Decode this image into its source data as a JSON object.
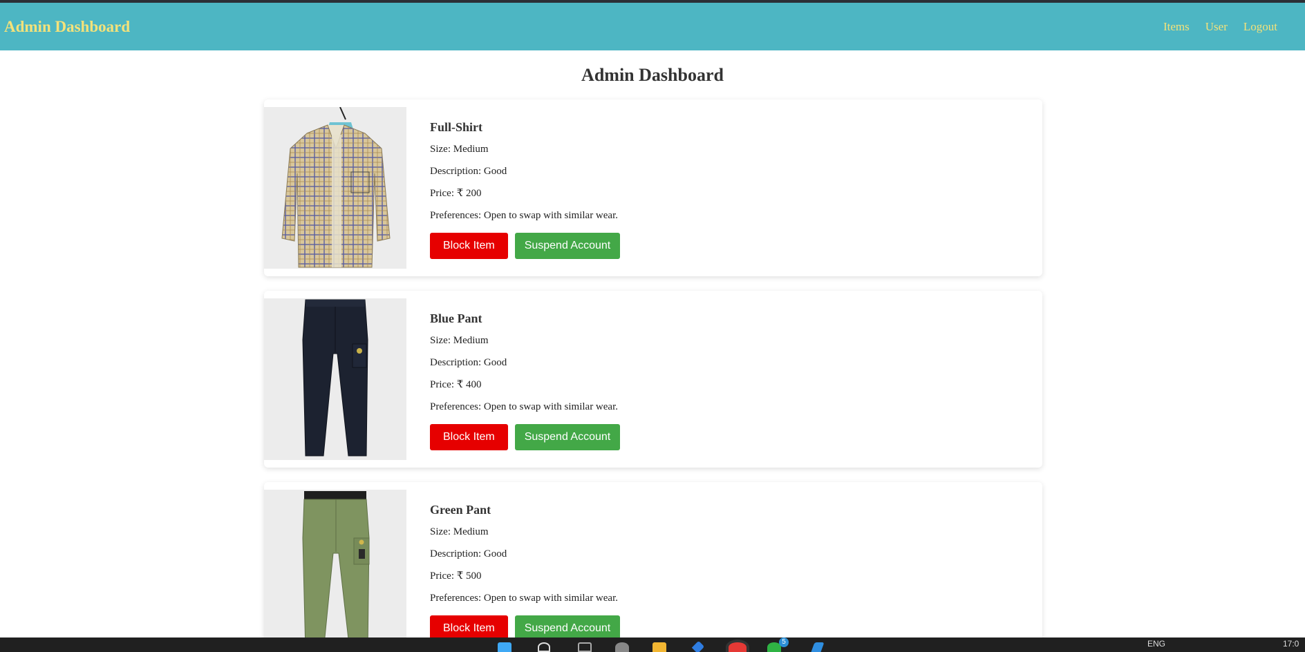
{
  "navbar": {
    "brand": "Admin Dashboard",
    "links": [
      "Items",
      "User",
      "Logout"
    ]
  },
  "page": {
    "title": "Admin Dashboard"
  },
  "items": [
    {
      "name": "Full-Shirt",
      "size": "Size: Medium",
      "description": "Description: Good",
      "price": "Price: ₹ 200",
      "preferences": "Preferences: Open to swap with similar wear.",
      "block_label": "Block Item",
      "suspend_label": "Suspend Account",
      "image": "plaid-shirt-image"
    },
    {
      "name": "Blue Pant",
      "size": "Size: Medium",
      "description": "Description: Good",
      "price": "Price: ₹ 400",
      "preferences": "Preferences: Open to swap with similar wear.",
      "block_label": "Block Item",
      "suspend_label": "Suspend Account",
      "image": "navy-cargo-pant-image"
    },
    {
      "name": "Green Pant",
      "size": "Size: Medium",
      "description": "Description: Good",
      "price": "Price: ₹ 500",
      "preferences": "Preferences: Open to swap with similar wear.",
      "block_label": "Block Item",
      "suspend_label": "Suspend Account",
      "image": "olive-cargo-pant-image"
    }
  ],
  "taskbar": {
    "lang": "ENG",
    "time": "17:0",
    "badge": "5"
  },
  "colors": {
    "navbar_bg": "#4db6c3",
    "nav_text": "#f4e27a",
    "block_button": "#e60000",
    "suspend_button": "#43a847"
  }
}
